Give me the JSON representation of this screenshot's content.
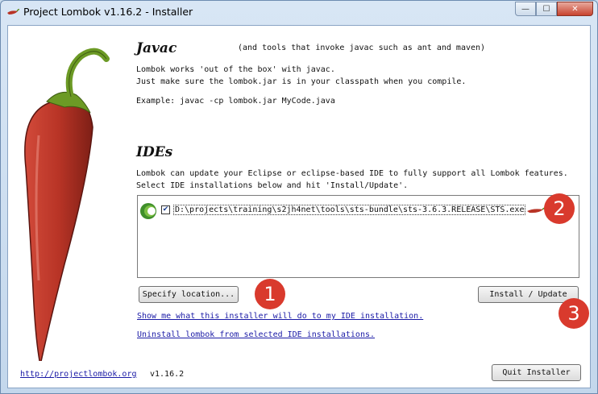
{
  "window": {
    "title": "Project Lombok v1.16.2 - Installer",
    "minimize_glyph": "—",
    "maximize_glyph": "☐",
    "close_glyph": "✕"
  },
  "javac": {
    "heading": "Javac",
    "subheading": "(and tools that invoke javac such as ant and maven)",
    "line1": "Lombok works 'out of the box' with javac.",
    "line2": "Just make sure the lombok.jar is in your classpath when you compile.",
    "example": "Example: javac -cp lombok.jar MyCode.java"
  },
  "ides": {
    "heading": "IDEs",
    "line1": "Lombok can update your Eclipse or eclipse-based IDE to fully support all Lombok features.",
    "line2": "Select IDE installations below and hit 'Install/Update'.",
    "installations": [
      {
        "path": "D:\\projects\\training\\s2jh4net\\tools\\sts-bundle\\sts-3.6.3.RELEASE\\STS.exe",
        "checked": true
      }
    ]
  },
  "buttons": {
    "specify_location": "Specify location...",
    "install_update": "Install / Update",
    "quit": "Quit Installer"
  },
  "links": {
    "show_me": "Show me what this installer will do to my IDE installation.",
    "uninstall": "Uninstall lombok from selected IDE installations.",
    "website": "http://projectlombok.org"
  },
  "version": "v1.16.2",
  "callouts": [
    "1",
    "2",
    "3"
  ],
  "icons": {
    "app": "chili-pepper-icon",
    "ide": "eclipse-sts-icon",
    "ide_marker": "chili-pepper-icon"
  },
  "colors": {
    "callout": "#d93a2d",
    "pepper": "#b83426",
    "link": "#1a1aa6"
  }
}
